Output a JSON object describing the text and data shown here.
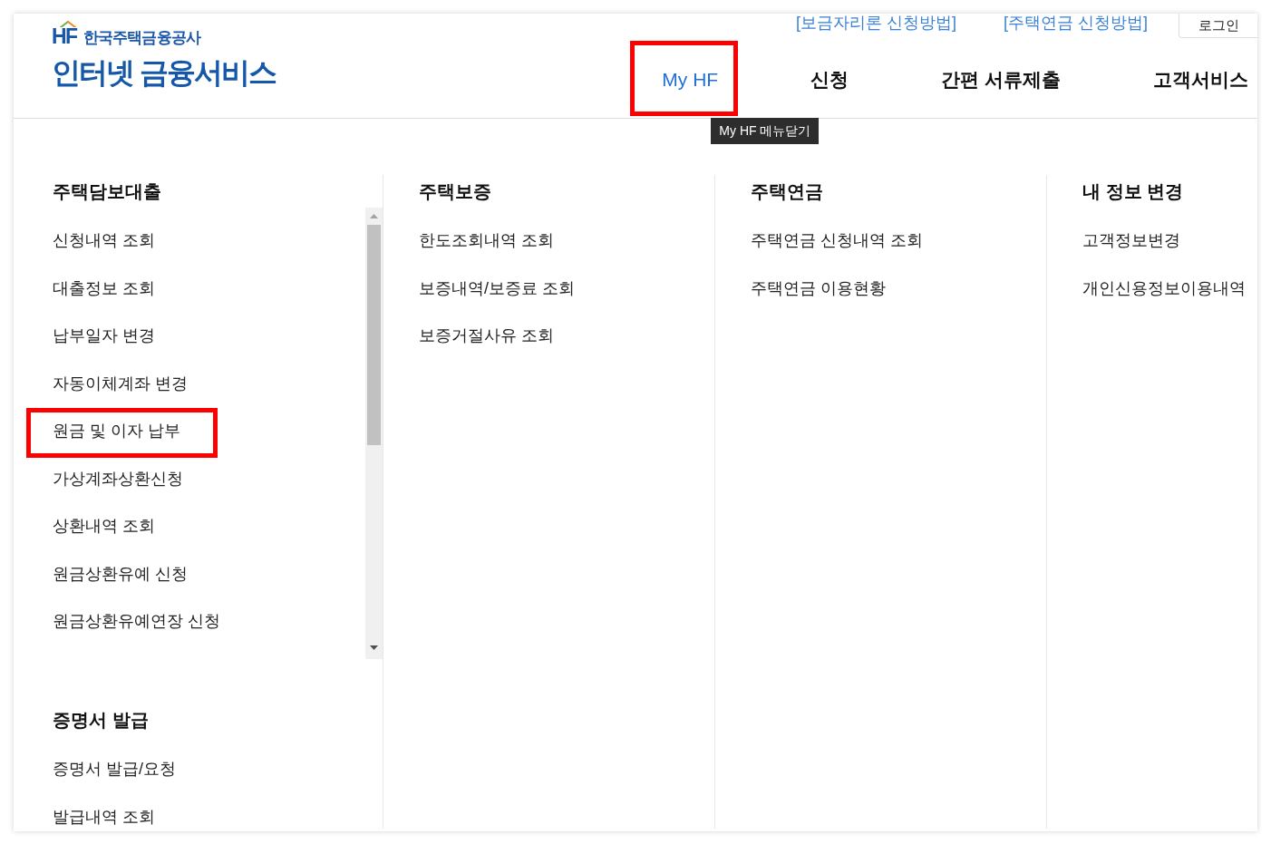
{
  "header": {
    "logo": {
      "mark": "HF",
      "org": "한국주택금융공사",
      "title": "인터넷 금융서비스"
    },
    "util_links": [
      "[보금자리론 신청방법]",
      "[주택연금 신청방법]"
    ],
    "login_button": "로그인",
    "nav": [
      {
        "label": "My HF",
        "selected": true,
        "highlighted": true
      },
      {
        "label": "신청",
        "selected": false,
        "highlighted": false
      },
      {
        "label": "간편 서류제출",
        "selected": false,
        "highlighted": false
      },
      {
        "label": "고객서비스",
        "selected": false,
        "highlighted": false
      }
    ],
    "tooltip": "My HF 메뉴닫기"
  },
  "menu": {
    "columns": [
      {
        "sections": [
          {
            "heading": "주택담보대출",
            "scrollable": true,
            "items": [
              {
                "label": "신청내역 조회",
                "highlighted": false
              },
              {
                "label": "대출정보 조회",
                "highlighted": false
              },
              {
                "label": "납부일자 변경",
                "highlighted": false
              },
              {
                "label": "자동이체계좌 변경",
                "highlighted": false
              },
              {
                "label": "원금 및 이자 납부",
                "highlighted": true
              },
              {
                "label": "가상계좌상환신청",
                "highlighted": false
              },
              {
                "label": "상환내역 조회",
                "highlighted": false
              },
              {
                "label": "원금상환유예 신청",
                "highlighted": false
              },
              {
                "label": "원금상환유예연장 신청",
                "highlighted": false
              }
            ]
          },
          {
            "heading": "증명서 발급",
            "scrollable": false,
            "items": [
              {
                "label": "증명서 발급/요청",
                "highlighted": false
              },
              {
                "label": "발급내역 조회",
                "highlighted": false
              }
            ]
          }
        ]
      },
      {
        "sections": [
          {
            "heading": "주택보증",
            "scrollable": false,
            "items": [
              {
                "label": "한도조회내역 조회",
                "highlighted": false
              },
              {
                "label": "보증내역/보증료 조회",
                "highlighted": false
              },
              {
                "label": "보증거절사유 조회",
                "highlighted": false
              }
            ]
          }
        ]
      },
      {
        "sections": [
          {
            "heading": "주택연금",
            "scrollable": false,
            "items": [
              {
                "label": "주택연금 신청내역 조회",
                "highlighted": false
              },
              {
                "label": "주택연금 이용현황",
                "highlighted": false
              }
            ]
          }
        ]
      },
      {
        "sections": [
          {
            "heading": "내 정보 변경",
            "scrollable": false,
            "items": [
              {
                "label": "고객정보변경",
                "highlighted": false
              },
              {
                "label": "개인신용정보이용내역",
                "highlighted": false
              }
            ]
          }
        ]
      }
    ]
  }
}
